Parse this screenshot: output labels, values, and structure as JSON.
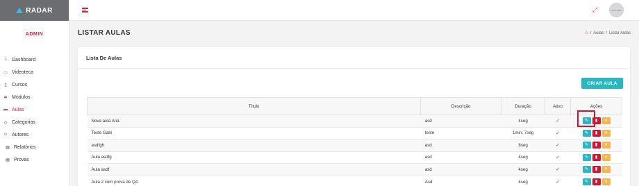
{
  "app": {
    "logo_text": "RADAR",
    "profile_name": "ADMIN",
    "avatar_text": "#### ####"
  },
  "colors": {
    "accent": "#e02a3c",
    "primary_button": "#28b8c4",
    "delete": "#d9132f",
    "cancel": "#f5b64a",
    "highlight": "#e0102a"
  },
  "sidebar": {
    "items": [
      {
        "label": "Dashboard",
        "icon": "home-icon",
        "glyph": "⌂",
        "active": false
      },
      {
        "label": "Videoteca",
        "icon": "video-icon",
        "glyph": "▭",
        "active": false
      },
      {
        "label": "Cursos",
        "icon": "document-icon",
        "glyph": "▯",
        "active": false
      },
      {
        "label": "Módulos",
        "icon": "modules-icon",
        "glyph": "✲",
        "active": false
      },
      {
        "label": "Aulas",
        "icon": "class-icon",
        "glyph": "▬",
        "active": true
      },
      {
        "label": "Categorias",
        "icon": "tag-icon",
        "glyph": "◇",
        "active": false
      },
      {
        "label": "Autores",
        "icon": "users-icon",
        "glyph": "☺",
        "active": false
      },
      {
        "label": "Relatórios",
        "icon": "report-icon",
        "glyph": "▤",
        "active": false,
        "sub": true
      },
      {
        "label": "Provas",
        "icon": "exam-icon",
        "glyph": "▤",
        "active": false,
        "sub": true
      }
    ]
  },
  "header": {
    "title": "LISTAR AULAS",
    "breadcrumb": {
      "sep": "/",
      "first": "Aulas",
      "current": "Listar Aulas"
    }
  },
  "card": {
    "title": "Lista De Aulas",
    "create_label": "CRIAR AULA"
  },
  "table": {
    "columns": {
      "title": "Título",
      "description": "Descrição",
      "duration": "Duração",
      "active": "Ativo",
      "actions": "Ações"
    },
    "rows": [
      {
        "title": "Nova aula Ana",
        "description": "asd",
        "duration": "4seg",
        "active": true
      },
      {
        "title": "Teste Gabi",
        "description": "teste",
        "duration": "1min, 7seg",
        "active": true
      },
      {
        "title": "asdfgh",
        "description": "asd",
        "duration": "8seg",
        "active": true
      },
      {
        "title": "Aula asdfg",
        "description": "asd",
        "duration": "4seg",
        "active": true
      },
      {
        "title": "Aula asdf",
        "description": "asd",
        "duration": "4seg",
        "active": true
      },
      {
        "title": "Aula 2 com prova de QA",
        "description": "Asd",
        "duration": "4seg",
        "active": true
      }
    ]
  }
}
